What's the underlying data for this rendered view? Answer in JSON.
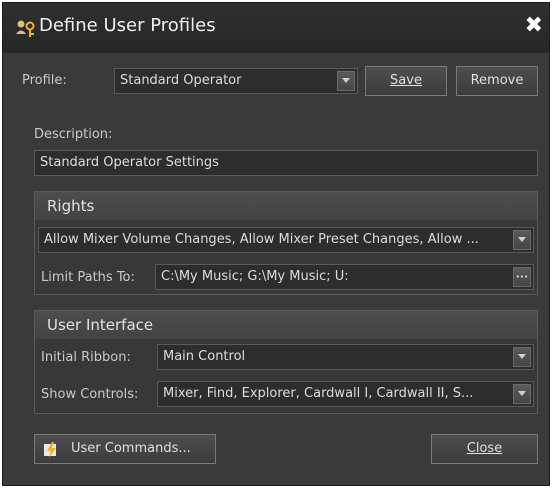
{
  "window": {
    "title": "Define User Profiles",
    "close_glyph": "✖"
  },
  "profile": {
    "label": "Profile:",
    "value": "Standard Operator",
    "save_label": "Save",
    "remove_label": "Remove"
  },
  "description": {
    "label": "Description:",
    "value": "Standard Operator Settings"
  },
  "rights": {
    "heading": "Rights",
    "permissions_value": "Allow Mixer Volume Changes, Allow Mixer Preset Changes, Allow ...",
    "limit_paths_label": "Limit Paths To:",
    "limit_paths_value": "C:\\My Music; G:\\My Music; U:",
    "browse_glyph": "•••"
  },
  "user_interface": {
    "heading": "User Interface",
    "initial_ribbon_label": "Initial Ribbon:",
    "initial_ribbon_value": "Main Control",
    "show_controls_label": "Show Controls:",
    "show_controls_value": "Mixer, Find, Explorer, Cardwall I, Cardwall II, S..."
  },
  "footer": {
    "user_commands_label": "User Commands...",
    "close_label": "Close"
  },
  "colors": {
    "background": "#3a3a3a",
    "field": "#2d2d2d",
    "icon_accent": "#f0b030"
  },
  "icons": {
    "title_icon": "user-key-icon",
    "user_commands_icon": "lightning-icon"
  }
}
